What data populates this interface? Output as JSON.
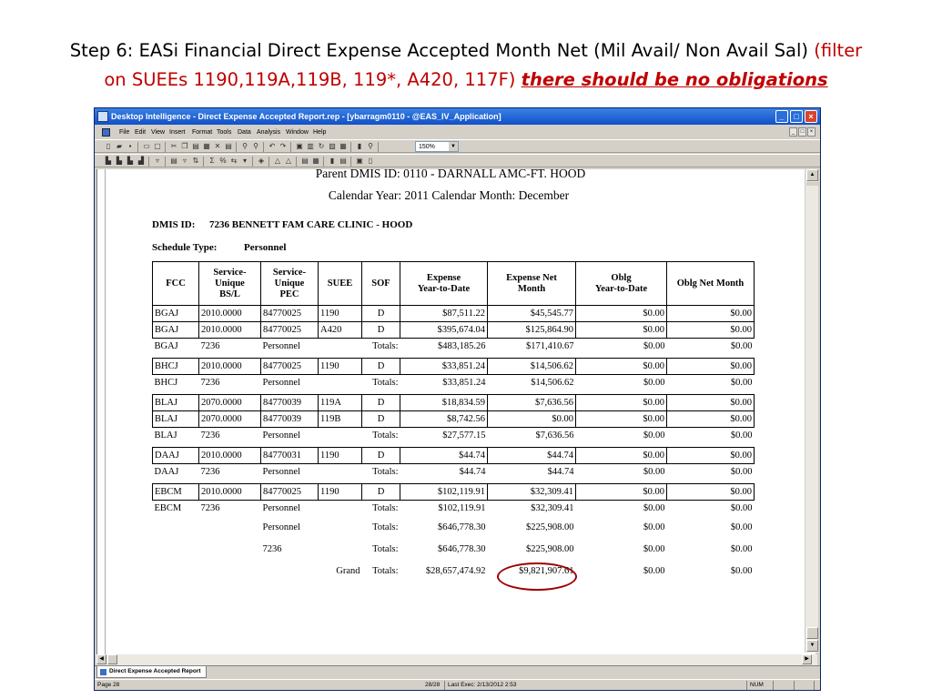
{
  "slide": {
    "title_black": "Step 6:  EASi Financial Direct Expense Accepted Month Net  (Mil Avail/ Non Avail Sal)",
    "title_red_1": "(filter",
    "title_red_2": "on SUEEs 1190,119A,119B, 119*, A420, 117F)",
    "title_emph": "there should be no obligations"
  },
  "window": {
    "title": "Desktop Intelligence - Direct Expense Accepted Report.rep - [ybarragm0110 - @EAS_IV_Application]",
    "buttons": [
      "_",
      "□",
      "×"
    ],
    "mdi_buttons": [
      "_",
      "□",
      "×"
    ]
  },
  "menu": [
    "File",
    "Edit",
    "View",
    "Insert",
    "Format",
    "Tools",
    "Data",
    "Analysis",
    "Window",
    "Help"
  ],
  "toolbar": {
    "zoom": "150%"
  },
  "report": {
    "header_line1": "Parent DMIS ID: 0110 - DARNALL AMC-FT. HOOD",
    "header_line2": "Calendar Year: 2011  Calendar Month: December",
    "dmis_label": "DMIS ID:",
    "dmis_value": "7236   BENNETT FAM CARE  CLINIC - HOOD",
    "schedule_label": "Schedule Type:",
    "schedule_value": "Personnel",
    "columns": [
      "FCC",
      "Service-\nUnique\nBS/L",
      "Service-\nUnique\nPEC",
      "SUEE",
      "SOF",
      "Expense\nYear-to-Date",
      "Expense Net\nMonth",
      "Oblg\nYear-to-Date",
      "Oblg Net Month"
    ],
    "rows": [
      {
        "type": "data",
        "cells": [
          "BGAJ",
          "2010.0000",
          "84770025",
          "1190",
          "D",
          "$87,511.22",
          "$45,545.77",
          "$0.00",
          "$0.00"
        ]
      },
      {
        "type": "data",
        "cells": [
          "BGAJ",
          "2010.0000",
          "84770025",
          "A420",
          "D",
          "$395,674.04",
          "$125,864.90",
          "$0.00",
          "$0.00"
        ]
      },
      {
        "type": "total",
        "cells": [
          "BGAJ",
          "7236",
          "Personnel",
          "",
          "Totals:",
          "$483,185.26",
          "$171,410.67",
          "$0.00",
          "$0.00"
        ]
      },
      {
        "type": "data",
        "cells": [
          "BHCJ",
          "2010.0000",
          "84770025",
          "1190",
          "D",
          "$33,851.24",
          "$14,506.62",
          "$0.00",
          "$0.00"
        ]
      },
      {
        "type": "total",
        "cells": [
          "BHCJ",
          "7236",
          "Personnel",
          "",
          "Totals:",
          "$33,851.24",
          "$14,506.62",
          "$0.00",
          "$0.00"
        ]
      },
      {
        "type": "data",
        "cells": [
          "BLAJ",
          "2070.0000",
          "84770039",
          "119A",
          "D",
          "$18,834.59",
          "$7,636.56",
          "$0.00",
          "$0.00"
        ]
      },
      {
        "type": "data",
        "cells": [
          "BLAJ",
          "2070.0000",
          "84770039",
          "119B",
          "D",
          "$8,742.56",
          "$0.00",
          "$0.00",
          "$0.00"
        ]
      },
      {
        "type": "total",
        "cells": [
          "BLAJ",
          "7236",
          "Personnel",
          "",
          "Totals:",
          "$27,577.15",
          "$7,636.56",
          "$0.00",
          "$0.00"
        ]
      },
      {
        "type": "data",
        "cells": [
          "DAAJ",
          "2010.0000",
          "84770031",
          "1190",
          "D",
          "$44.74",
          "$44.74",
          "$0.00",
          "$0.00"
        ]
      },
      {
        "type": "total",
        "cells": [
          "DAAJ",
          "7236",
          "Personnel",
          "",
          "Totals:",
          "$44.74",
          "$44.74",
          "$0.00",
          "$0.00"
        ]
      },
      {
        "type": "data",
        "cells": [
          "EBCM",
          "2010.0000",
          "84770025",
          "1190",
          "D",
          "$102,119.91",
          "$32,309.41",
          "$0.00",
          "$0.00"
        ]
      },
      {
        "type": "total",
        "cells": [
          "EBCM",
          "7236",
          "Personnel",
          "",
          "Totals:",
          "$102,119.91",
          "$32,309.41",
          "$0.00",
          "$0.00"
        ]
      },
      {
        "type": "foot",
        "cells": [
          "",
          "",
          "Personnel",
          "",
          "Totals:",
          "$646,778.30",
          "$225,908.00",
          "$0.00",
          "$0.00"
        ]
      },
      {
        "type": "foot",
        "cells": [
          "",
          "",
          "7236",
          "",
          "Totals:",
          "$646,778.30",
          "$225,908.00",
          "$0.00",
          "$0.00"
        ]
      },
      {
        "type": "foot",
        "cells": [
          "",
          "",
          "",
          "Grand",
          "Totals:",
          "$28,657,474.92",
          "$9,821,907.61",
          "$0.00",
          "$0.00"
        ]
      }
    ]
  },
  "tab": {
    "label": "Direct Expense Accepted Report"
  },
  "status": {
    "page": "Page 28",
    "pages": "28/28",
    "last_exec": "Last Exec: 2/13/2012 2:53",
    "num": "NUM"
  }
}
